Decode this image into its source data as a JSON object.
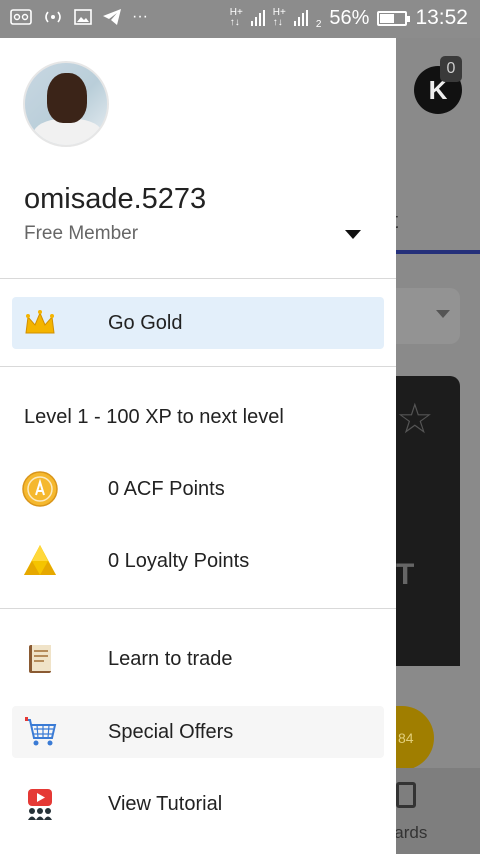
{
  "status_bar": {
    "left_icons": [
      "voicemail-icon",
      "hotspot-icon",
      "image-icon",
      "telegram-icon",
      "more-icon"
    ],
    "net1": "H+",
    "net2": "H+",
    "sim": "2",
    "battery_percent": "56%",
    "battery_level": 0.56,
    "time": "13:52"
  },
  "drawer": {
    "username": "omisade.5273",
    "member_type": "Free Member",
    "items": [
      {
        "label": "Go Gold",
        "icon": "crown-icon"
      },
      {
        "label": "0 ACF Points",
        "icon": "acf-coin-icon"
      },
      {
        "label": "0 Loyalty Points",
        "icon": "loyalty-triangle-icon"
      },
      {
        "label": "Learn to trade",
        "icon": "book-icon"
      },
      {
        "label": "Special Offers",
        "icon": "cart-icon"
      },
      {
        "label": "View Tutorial",
        "icon": "tutorial-icon"
      }
    ],
    "level_text": "Level 1 - 100 XP to next level"
  },
  "background": {
    "badge": "0",
    "logo_letter": "K",
    "tab_fragment": "t",
    "card_text": "T",
    "coin_fragment": "84",
    "bottom_label_fragment": "wards"
  },
  "colors": {
    "gold_highlight": "#e3effa",
    "tab_indicator": "#25307a"
  }
}
